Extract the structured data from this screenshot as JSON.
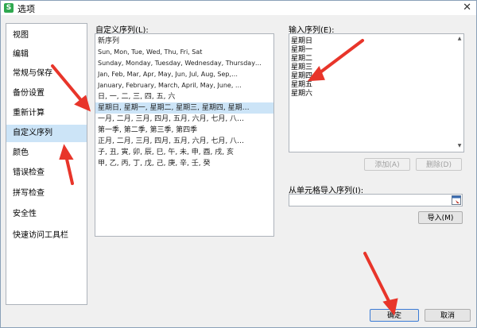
{
  "window": {
    "title": "选项",
    "app_icon": "S"
  },
  "sidebar": {
    "items": [
      {
        "label": "视图"
      },
      {
        "label": "编辑"
      },
      {
        "label": "常规与保存"
      },
      {
        "label": "备份设置"
      },
      {
        "label": "重新计算"
      },
      {
        "label": "自定义序列",
        "selected": true
      },
      {
        "label": "颜色"
      },
      {
        "label": "错误检查"
      },
      {
        "label": "拼写检查"
      },
      {
        "label": "安全性"
      },
      {
        "label": "快速访问工具栏"
      }
    ]
  },
  "custom_list": {
    "label": "自定义序列(L):",
    "items": [
      "新序列",
      "Sun, Mon, Tue, Wed, Thu, Fri, Sat",
      "Sunday, Monday, Tuesday, Wednesday, Thursday…",
      "Jan, Feb, Mar, Apr, May, Jun, Jul, Aug, Sep,…",
      "January, February, March, April, May, June, …",
      "日, 一, 二, 三, 四, 五, 六",
      "星期日, 星期一, 星期二, 星期三, 星期四, 星期…",
      "一月, 二月, 三月, 四月, 五月, 六月, 七月, 八…",
      "第一季, 第二季, 第三季, 第四季",
      "正月, 二月, 三月, 四月, 五月, 六月, 七月, 八…",
      "子, 丑, 寅, 卯, 辰, 巳, 午, 未, 申, 酉, 戌, 亥",
      "甲, 乙, 丙, 丁, 戊, 己, 庚, 辛, 壬, 癸"
    ],
    "selected_index": 6
  },
  "input_sequence": {
    "label": "输入序列(E):",
    "lines": [
      "星期日",
      "星期一",
      "星期二",
      "星期三",
      "星期四",
      "星期五",
      "星期六"
    ]
  },
  "buttons": {
    "add": "添加(A)",
    "delete": "删除(D)",
    "import": "导入(M)",
    "ok": "确定",
    "cancel": "取消"
  },
  "import_from_cells": {
    "label": "从单元格导入序列(I):",
    "value": ""
  },
  "colors": {
    "selection": "#cce4f7",
    "annotation_arrow": "#e8352a"
  }
}
